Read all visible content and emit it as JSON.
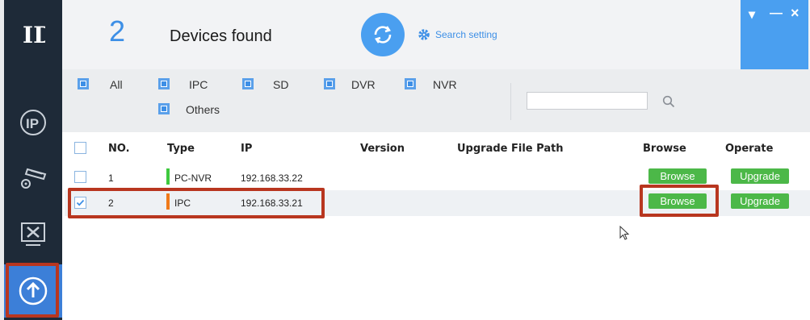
{
  "header": {
    "count": "2",
    "title": "Devices found",
    "search_setting": "Search setting"
  },
  "window": {
    "menu": "▾",
    "minimize": "—",
    "close": "×"
  },
  "sidebar": {
    "logo": "ID",
    "items": [
      "ip-icon",
      "camera-settings-icon",
      "tools-icon",
      "upgrade-icon"
    ]
  },
  "filters": {
    "all": "All",
    "ipc": "IPC",
    "sd": "SD",
    "dvr": "DVR",
    "nvr": "NVR",
    "others": "Others",
    "search_value": ""
  },
  "table": {
    "columns": [
      "NO.",
      "Type",
      "IP",
      "Version",
      "Upgrade File Path",
      "Browse",
      "Operate"
    ],
    "rows": [
      {
        "no": "1",
        "type": "PC-NVR",
        "type_color": "#3ec93e",
        "ip": "192.168.33.22",
        "version": "",
        "path": "",
        "browse": "Browse",
        "operate": "Upgrade",
        "checked": false
      },
      {
        "no": "2",
        "type": "IPC",
        "type_color": "#f07a1a",
        "ip": "192.168.33.21",
        "version": "",
        "path": "",
        "browse": "Browse",
        "operate": "Upgrade",
        "checked": true
      }
    ]
  },
  "colors": {
    "accent": "#4a9ff0",
    "sidebar": "#1e2a38",
    "button_green": "#4cb848",
    "highlight": "#b8361f"
  }
}
